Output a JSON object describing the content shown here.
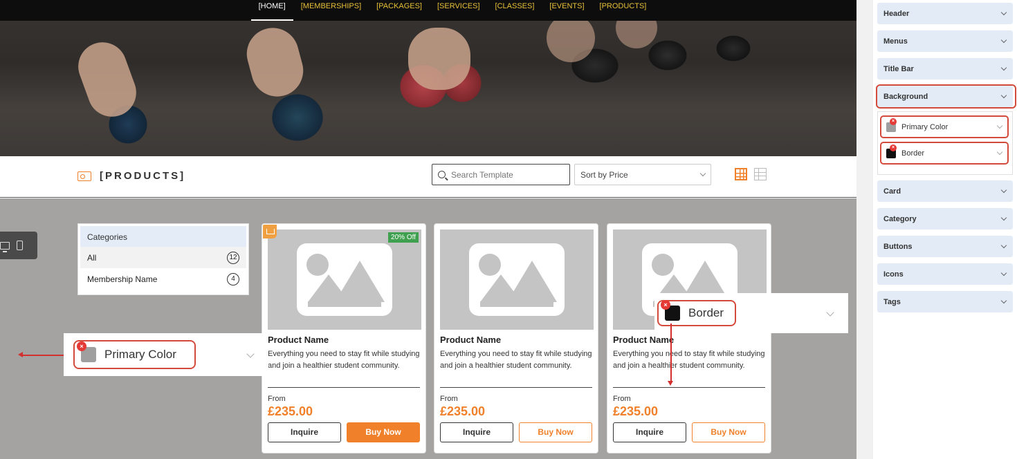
{
  "nav": {
    "items": [
      {
        "label": "[HOME]",
        "active": true
      },
      {
        "label": "[MEMBERSHIPS]",
        "active": false
      },
      {
        "label": "[PACKAGES]",
        "active": false
      },
      {
        "label": "[SERVICES]",
        "active": false
      },
      {
        "label": "[CLASSES]",
        "active": false
      },
      {
        "label": "[EVENTS]",
        "active": false
      },
      {
        "label": "[PRODUCTS]",
        "active": false
      }
    ]
  },
  "products_header": {
    "title": "[PRODUCTS]",
    "search_placeholder": "Search Template",
    "sort_value": "Sort by Price"
  },
  "categories": {
    "heading": "Categories",
    "items": [
      {
        "label": "All",
        "count": "12"
      },
      {
        "label": "Membership Name",
        "count": "4"
      }
    ]
  },
  "cards": [
    {
      "name": "Product Name",
      "description": "Everything you need to stay fit while studying and join a healthier student community.",
      "from_label": "From",
      "price": "£235.00",
      "inquire_label": "Inquire",
      "buy_label": "Buy Now",
      "badge": "20% Off"
    },
    {
      "name": "Product Name",
      "description": "Everything you need to stay fit while studying and join a healthier student community.",
      "from_label": "From",
      "price": "£235.00",
      "inquire_label": "Inquire",
      "buy_label": "Buy Now"
    },
    {
      "name": "Product Name",
      "description": "Everything you need to stay fit while studying and join a healthier student community.",
      "from_label": "From",
      "price": "£235.00",
      "inquire_label": "Inquire",
      "buy_label": "Buy Now"
    }
  ],
  "callouts": {
    "primary_color": {
      "label": "Primary Color",
      "color": "#9f9f9f"
    },
    "border": {
      "label": "Border",
      "color": "#111111"
    }
  },
  "panel": {
    "sections": [
      "Header",
      "Menus",
      "Title Bar",
      "Background",
      "Card",
      "Category",
      "Buttons",
      "Icons",
      "Tags"
    ],
    "background_items": [
      {
        "label": "Primary Color",
        "color": "#9f9f9f"
      },
      {
        "label": "Border",
        "color": "#111111"
      }
    ]
  },
  "colors": {
    "accent": "#f0802a",
    "highlight": "#d44a3a",
    "badge_green": "#3fa14f",
    "nav_gold": "#e8c13a"
  },
  "icons": [
    "crown-icon",
    "search-icon",
    "grid-view-icon",
    "list-view-icon",
    "desktop-icon",
    "mobile-icon",
    "image-placeholder-icon",
    "chevron-down-icon",
    "remove-icon"
  ]
}
